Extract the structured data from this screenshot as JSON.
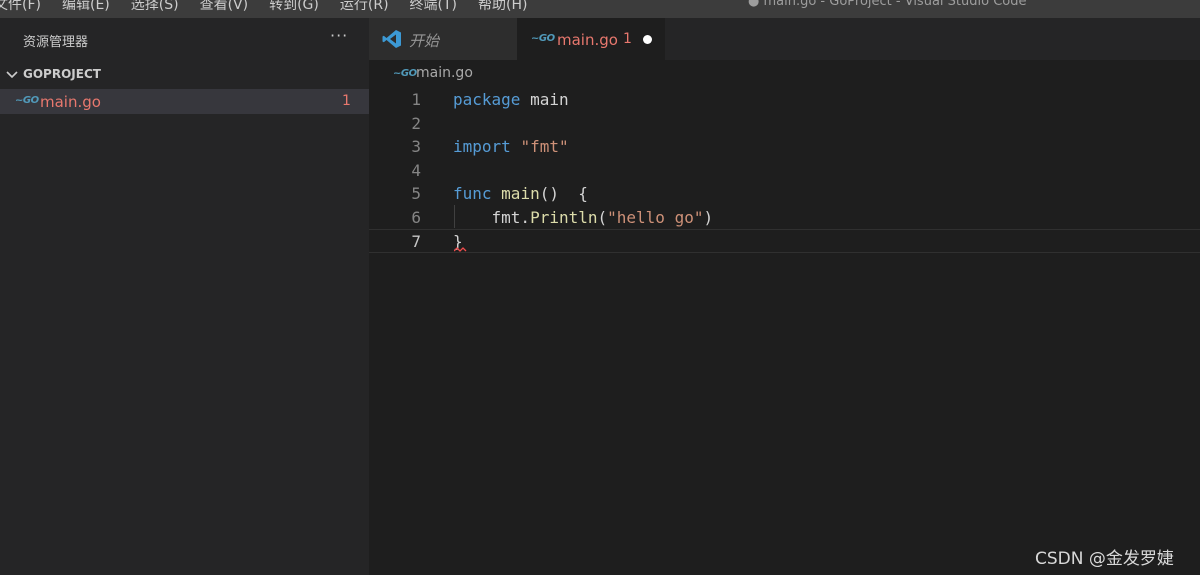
{
  "window": {
    "title": "● main.go - GoProject - Visual Studio Code"
  },
  "menu": {
    "items": [
      "文件(F)",
      "编辑(E)",
      "选择(S)",
      "查看(V)",
      "转到(G)",
      "运行(R)",
      "终端(T)",
      "帮助(H)"
    ]
  },
  "sidebar": {
    "title": "资源管理器",
    "more_label": "···",
    "project": "GOPROJECT",
    "file": {
      "icon_text": "~GO",
      "name": "main.go",
      "problems": "1"
    }
  },
  "tabs": {
    "start": {
      "label": "开始"
    },
    "main": {
      "icon_text": "~GO",
      "label": "main.go",
      "problems": "1"
    }
  },
  "breadcrumb": {
    "icon_text": "~GO",
    "label": "main.go"
  },
  "code": {
    "line_numbers": [
      "1",
      "2",
      "3",
      "4",
      "5",
      "6",
      "7"
    ],
    "l1": {
      "kw": "package",
      "rest": " main"
    },
    "l3": {
      "kw": "import",
      "sp": " ",
      "str": "\"fmt\""
    },
    "l5": {
      "kw": "func",
      "sp": " ",
      "fn": "main",
      "rest": "()  {"
    },
    "l6": {
      "indent": "    ",
      "pkg": "fmt.",
      "fn": "Println",
      "open": "(",
      "str": "\"hello go\"",
      "close": ")"
    },
    "l7": {
      "text": "}"
    }
  },
  "watermark": "CSDN @金发罗婕",
  "colors": {
    "keyword": "#569cd6",
    "function": "#dcdcaa",
    "string": "#ce9178",
    "error": "#e8786e",
    "go_icon": "#519aba"
  }
}
